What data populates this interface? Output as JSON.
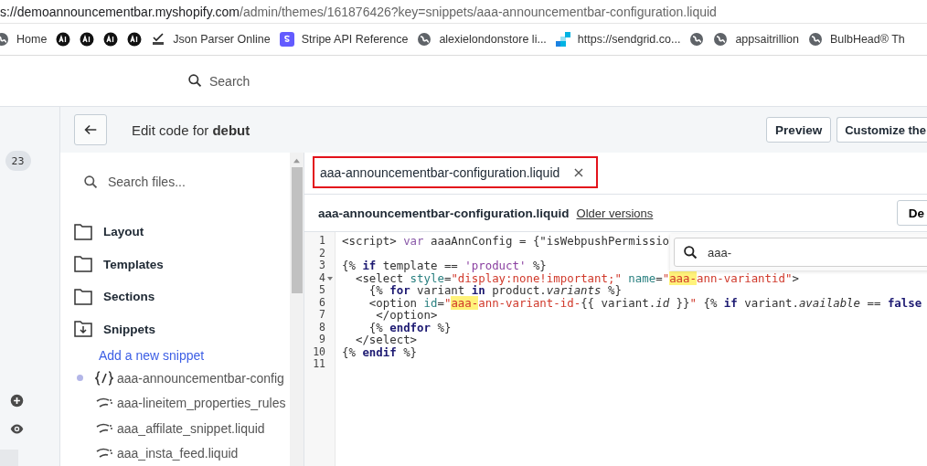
{
  "browser": {
    "url_host": "s://demoannouncementbar.myshopify.com",
    "url_path": "/admin/themes/161876426?key=snippets/aaa-announcementbar-configuration.liquid",
    "bookmarks": [
      {
        "kind": "globe",
        "label": "Home"
      },
      {
        "kind": "ai"
      },
      {
        "kind": "ai"
      },
      {
        "kind": "ai"
      },
      {
        "kind": "ai"
      },
      {
        "kind": "json",
        "label": "Json Parser Online"
      },
      {
        "kind": "stripe",
        "label": "Stripe API Reference"
      },
      {
        "kind": "globe",
        "label": "alexielondonstore li..."
      },
      {
        "kind": "sendgrid",
        "label": "https://sendgrid.co..."
      },
      {
        "kind": "globe"
      },
      {
        "kind": "globe",
        "label": "appsaitrillion"
      },
      {
        "kind": "globe",
        "label": "BulbHead® Th"
      }
    ]
  },
  "topbar": {
    "search_placeholder": "Search"
  },
  "nav": {
    "badge": "23"
  },
  "header": {
    "title_prefix": "Edit code for ",
    "theme": "debut",
    "buttons": [
      "Preview",
      "Customize the"
    ]
  },
  "sidebar": {
    "search_placeholder": "Search files...",
    "folders": [
      {
        "label": "Layout",
        "expanded": false
      },
      {
        "label": "Templates",
        "expanded": false
      },
      {
        "label": "Sections",
        "expanded": false
      },
      {
        "label": "Snippets",
        "expanded": true
      }
    ],
    "add_link": "Add a new snippet",
    "files": [
      {
        "kind": "code",
        "name": "aaa-announcementbar-config",
        "modified": true
      },
      {
        "kind": "liquid",
        "name": "aaa-lineitem_properties_rules",
        "modified": false
      },
      {
        "kind": "liquid",
        "name": "aaa_affilate_snippet.liquid",
        "modified": false
      },
      {
        "kind": "liquid",
        "name": "aaa_insta_feed.liquid",
        "modified": false
      }
    ]
  },
  "editor": {
    "tabs": [
      {
        "label": "aaa-announcementbar-configuration.liquid",
        "close": "×",
        "highlighted": true
      }
    ],
    "filename": "aaa-announcementbar-configuration.liquid",
    "older_link": "Older versions",
    "action_button": "De",
    "find": {
      "value": "aaa-"
    },
    "lines": [
      {
        "number": "1",
        "tokens": [
          {
            "kind": "plain",
            "text": "<script> "
          },
          {
            "kind": "var",
            "text": "var"
          },
          {
            "kind": "plain",
            "text": " aaaAnnConfig = {\"isWebpushPermissio"
          }
        ]
      },
      {
        "number": "2"
      },
      {
        "number": "3",
        "tokens": [
          {
            "kind": "plain",
            "text": "{% "
          },
          {
            "kind": "keyword",
            "text": "if"
          },
          {
            "kind": "plain",
            "text": " template == "
          },
          {
            "kind": "lstring",
            "text": "'product'"
          },
          {
            "kind": "plain",
            "text": " %}"
          }
        ]
      },
      {
        "number": "4",
        "fold": true,
        "tokens": [
          {
            "kind": "plain",
            "text": "  <select "
          },
          {
            "kind": "attr",
            "text": "style"
          },
          {
            "kind": "plain",
            "text": "="
          },
          {
            "kind": "string",
            "text": "\"display:none!important;\""
          },
          {
            "kind": "attr",
            "text": " name"
          },
          {
            "kind": "plain",
            "text": "="
          },
          {
            "kind": "string",
            "text": "\""
          },
          {
            "kind": "match",
            "text": "aaa-"
          },
          {
            "kind": "string",
            "text": "ann-variantid\""
          },
          {
            "kind": "plain",
            "text": ">"
          }
        ]
      },
      {
        "number": "5",
        "tokens": [
          {
            "kind": "plain",
            "text": "    {% "
          },
          {
            "kind": "keyword",
            "text": "for"
          },
          {
            "kind": "plain",
            "text": " variant "
          },
          {
            "kind": "keyword",
            "text": "in"
          },
          {
            "kind": "plain",
            "text": " product."
          },
          {
            "kind": "italic",
            "text": "variants"
          },
          {
            "kind": "plain",
            "text": " %}"
          }
        ]
      },
      {
        "number": "6",
        "tokens": [
          {
            "kind": "plain",
            "text": "    <option "
          },
          {
            "kind": "attr",
            "text": "id"
          },
          {
            "kind": "plain",
            "text": "="
          },
          {
            "kind": "string",
            "text": "\""
          },
          {
            "kind": "match",
            "text": "aaa-"
          },
          {
            "kind": "string",
            "text": "ann-variant-id-"
          },
          {
            "kind": "plain",
            "text": "{{ variant."
          },
          {
            "kind": "italic",
            "text": "id"
          },
          {
            "kind": "plain",
            "text": " }}"
          },
          {
            "kind": "string",
            "text": "\""
          },
          {
            "kind": "plain",
            "text": " {% "
          },
          {
            "kind": "keyword",
            "text": "if"
          },
          {
            "kind": "plain",
            "text": " variant."
          },
          {
            "kind": "italic",
            "text": "available"
          },
          {
            "kind": "plain",
            "text": " == "
          },
          {
            "kind": "keyword",
            "text": "false"
          }
        ]
      },
      {
        "number": "7",
        "tokens": [
          {
            "kind": "plain",
            "text": "     </option>"
          }
        ]
      },
      {
        "number": "8",
        "tokens": [
          {
            "kind": "plain",
            "text": "    {% "
          },
          {
            "kind": "keyword",
            "text": "endfor"
          },
          {
            "kind": "plain",
            "text": " %}"
          }
        ]
      },
      {
        "number": "9",
        "tokens": [
          {
            "kind": "plain",
            "text": "  </select>"
          }
        ]
      },
      {
        "number": "10",
        "tokens": [
          {
            "kind": "plain",
            "text": "{% "
          },
          {
            "kind": "keyword",
            "text": "endif"
          },
          {
            "kind": "plain",
            "text": " %}"
          }
        ]
      },
      {
        "number": "11"
      }
    ]
  }
}
